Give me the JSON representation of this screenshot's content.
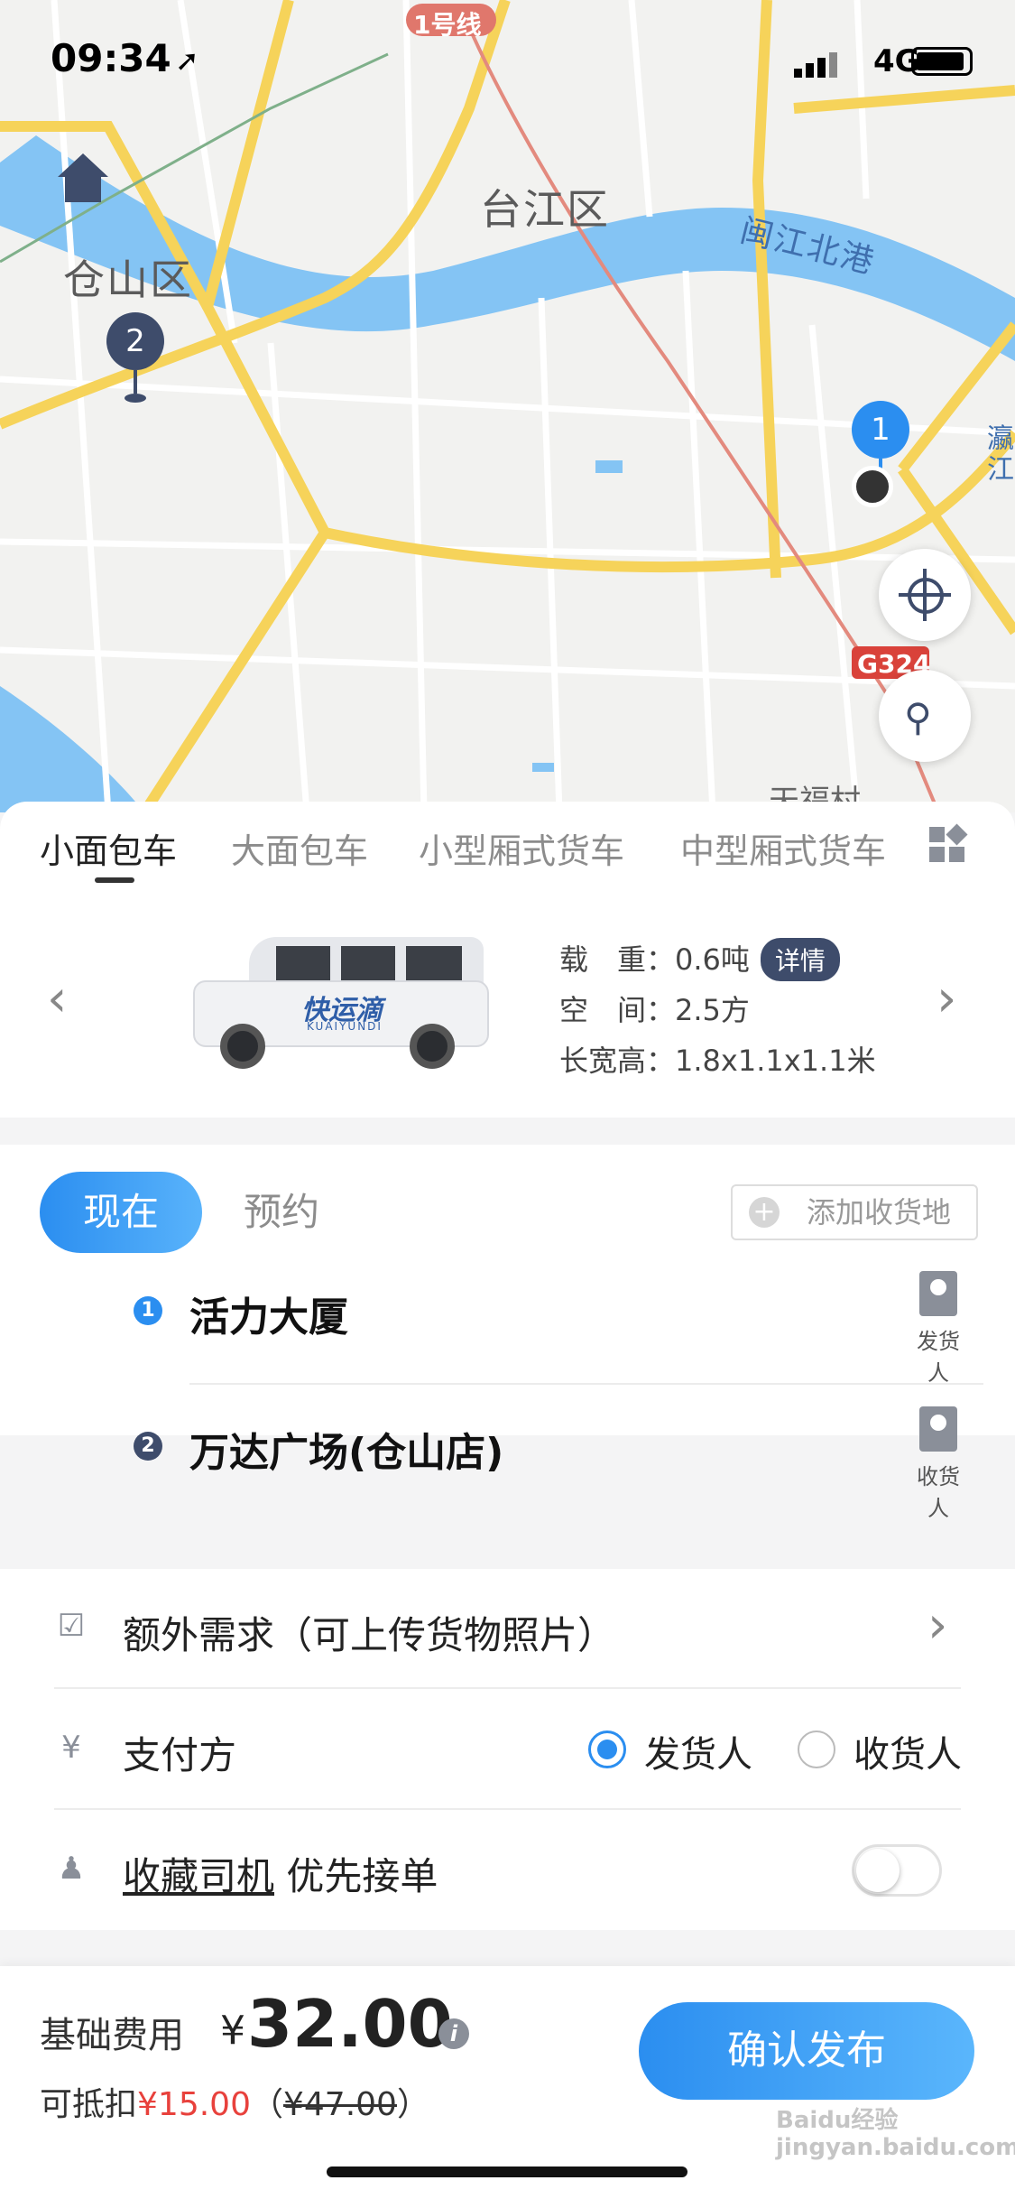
{
  "status": {
    "time": "09:34",
    "network": "4G"
  },
  "map": {
    "districts": [
      "台江区",
      "仓山区"
    ],
    "river_label": "闽江北港",
    "metro_label": "1号线",
    "highway_label": "G324",
    "village_label": "天福村",
    "edge_label": "瀛江",
    "marker_1": "1",
    "marker_2": "2"
  },
  "vehicle_tabs": [
    "小面包车",
    "大面包车",
    "小型厢式货车",
    "中型厢式货车"
  ],
  "vehicle": {
    "brand_cn": "快运滴",
    "brand_en": "KUAIYUNDI",
    "load_label": "载　重：",
    "load_value": "0.6吨",
    "detail_badge": "详情",
    "space_label": "空　间：",
    "space_value": "2.5方",
    "dims_label": "长宽高：",
    "dims_value": "1.8x1.1x1.1米"
  },
  "schedule": {
    "now": "现在",
    "later": "预约",
    "add_destination": "添加收货地"
  },
  "route": [
    {
      "index": "1",
      "address": "活力大厦",
      "contact_label": "发货人",
      "color": "#2b8ef0"
    },
    {
      "index": "2",
      "address": "万达广场(仓山店)",
      "contact_label": "收货人",
      "color": "#3e4c6b"
    }
  ],
  "options": {
    "extra": "额外需求（可上传货物照片）",
    "payer_label": "支付方",
    "payer_options": [
      "发货人",
      "收货人"
    ],
    "payer_selected": "发货人",
    "fav_driver": "收藏司机",
    "fav_driver_suffix": " 优先接单",
    "fav_driver_enabled": false
  },
  "price": {
    "label": "基础费用",
    "currency": "¥",
    "amount": "32.00",
    "deduct_label": "可抵扣",
    "deduct_value": "¥15.00",
    "original_prefix": "（",
    "original_value": "¥47.00",
    "original_suffix": "）",
    "confirm": "确认发布"
  },
  "watermark": "Baidu经验  jingyan.baidu.com",
  "colors": {
    "accent": "#2b8ef0",
    "red": "#e8413c",
    "road": "#f6d35a",
    "water": "#7fc2f6"
  }
}
